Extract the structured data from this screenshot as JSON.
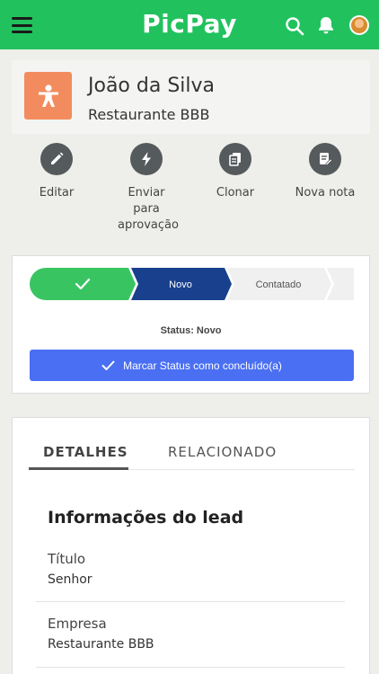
{
  "app": {
    "logo": "PicPay",
    "brand_color": "#21c25e"
  },
  "topbar": {
    "menu_icon": "hamburger-menu-icon",
    "search_icon": "search-icon",
    "notifications_icon": "bell-icon",
    "avatar_icon": "user-avatar"
  },
  "lead": {
    "icon": "person-lead-icon",
    "icon_color": "#f28c5e",
    "name": "João da Silva",
    "company": "Restaurante BBB"
  },
  "actions": [
    {
      "icon": "pencil-icon",
      "label": "Editar"
    },
    {
      "icon": "lightning-icon",
      "label": "Enviar para aprovação"
    },
    {
      "icon": "copy-icon",
      "label": "Clonar"
    },
    {
      "icon": "new-note-icon",
      "label": "Nova nota"
    }
  ],
  "status": {
    "stages": [
      {
        "label": "",
        "state": "completed",
        "color": "#39c462"
      },
      {
        "label": "Novo",
        "state": "current",
        "color": "#19408d"
      },
      {
        "label": "Contatado",
        "state": "upcoming",
        "color": "#f0f0f0"
      },
      {
        "label": "",
        "state": "upcoming",
        "color": "#f0f0f0"
      }
    ],
    "status_text": "Status: Novo",
    "complete_button": "Marcar Status como concluído(a)",
    "button_color": "#4a6ff2"
  },
  "details": {
    "tabs": [
      {
        "label": "DETALHES",
        "active": true
      },
      {
        "label": "RELACIONADO",
        "active": false
      }
    ],
    "section_title": "Informações do lead",
    "fields": [
      {
        "label": "Título",
        "value": "Senhor"
      },
      {
        "label": "Empresa",
        "value": "Restaurante BBB"
      }
    ]
  }
}
